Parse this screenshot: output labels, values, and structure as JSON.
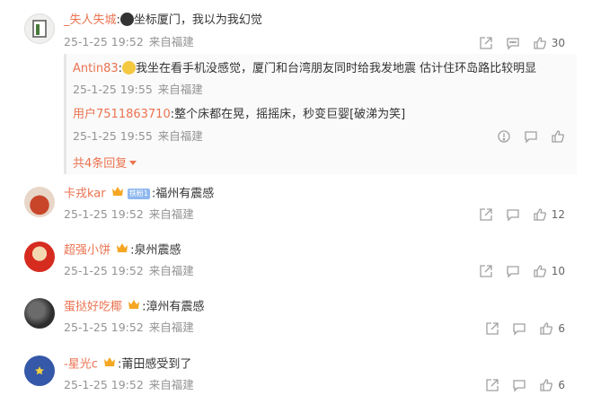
{
  "comments": [
    {
      "name": "_失人失城",
      "sep": ":",
      "text": "坐标厦门，我以为我幻觉",
      "date": "25-1-25 19:52",
      "location": "来自福建",
      "likes": "30"
    },
    {
      "name": "卡戎kar",
      "sep": ":",
      "badge": "铁粉1",
      "text": "福州有震感",
      "date": "25-1-25 19:52",
      "location": "来自福建",
      "likes": "12"
    },
    {
      "name": "超强小饼",
      "sep": ":",
      "text": "泉州震感",
      "date": "25-1-25 19:52",
      "location": "来自福建",
      "likes": "10"
    },
    {
      "name": "蛋挞好吃椰",
      "sep": ":",
      "text": "漳州有震感",
      "date": "25-1-25 19:52",
      "location": "来自福建",
      "likes": "6"
    },
    {
      "name": "-星光c",
      "sep": ":",
      "text": "莆田感受到了",
      "date": "25-1-25 19:52",
      "location": "来自福建",
      "likes": "6"
    }
  ],
  "replies": [
    {
      "name": "Antin83",
      "sep": ":",
      "text": "我坐在看手机没感觉，厦门和台湾朋友同时给我发地震 估计住环岛路比较明显",
      "date": "25-1-25 19:55",
      "location": "来自福建"
    },
    {
      "name": "用户7511863710",
      "sep": ":",
      "text": "整个床都在晃，摇摇床，秒变巨婴[破涕为笑]",
      "date": "25-1-25 19:55",
      "location": "来自福建"
    }
  ],
  "more_replies": "共4条回复",
  "colors": {
    "name": "#eb7350",
    "meta": "#939393",
    "icon": "#a0a0a0"
  }
}
